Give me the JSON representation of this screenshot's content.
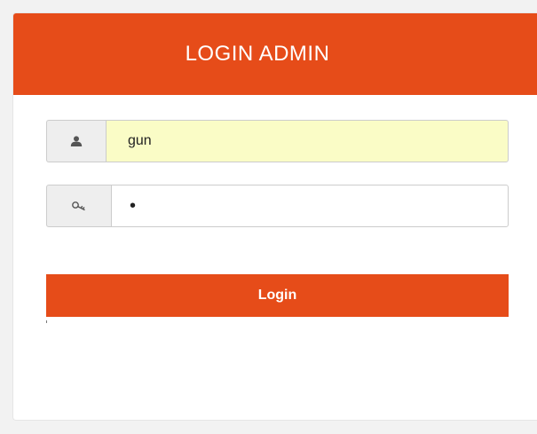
{
  "panel": {
    "title": "LOGIN ADMIN"
  },
  "form": {
    "username": {
      "icon": "user-icon",
      "value": "gun"
    },
    "password": {
      "icon": "key-icon",
      "value": "•"
    },
    "submit_label": "Login"
  },
  "colors": {
    "accent": "#e64c19",
    "autofill_bg": "#fafcc6",
    "addon_bg": "#eeeeee"
  }
}
